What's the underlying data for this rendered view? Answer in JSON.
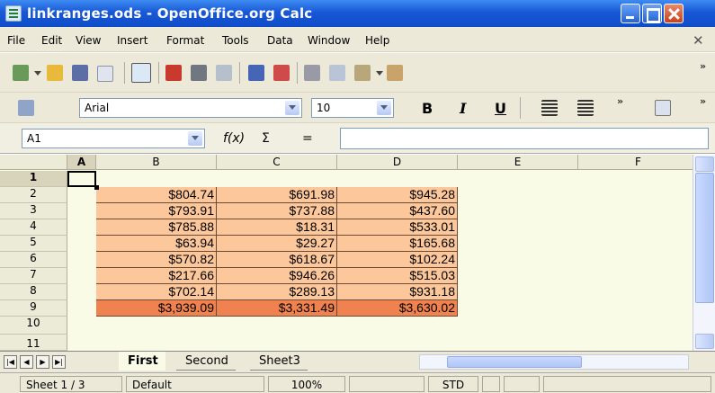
{
  "window": {
    "title": "linkranges.ods - OpenOffice.org Calc"
  },
  "menu": [
    "File",
    "Edit",
    "View",
    "Insert",
    "Format",
    "Tools",
    "Data",
    "Window",
    "Help"
  ],
  "format_bar": {
    "font_name": "Arial",
    "font_size": "10",
    "bold": "B",
    "italic": "I",
    "underline": "U"
  },
  "formula_bar": {
    "cell_ref": "A1",
    "function_wizard": "f(x)",
    "sum": "Σ",
    "equals": "=",
    "input_value": ""
  },
  "grid": {
    "columns": [
      "A",
      "B",
      "C",
      "D",
      "E",
      "F"
    ],
    "rows": [
      "1",
      "2",
      "3",
      "4",
      "5",
      "6",
      "7",
      "8",
      "9",
      "10",
      "11"
    ],
    "values": [
      [
        "$804.74",
        "$691.98",
        "$945.28"
      ],
      [
        "$793.91",
        "$737.88",
        "$437.60"
      ],
      [
        "$785.88",
        "$18.31",
        "$533.01"
      ],
      [
        "$63.94",
        "$29.27",
        "$165.68"
      ],
      [
        "$570.82",
        "$618.67",
        "$102.24"
      ],
      [
        "$217.66",
        "$946.26",
        "$515.03"
      ],
      [
        "$702.14",
        "$289.13",
        "$931.18"
      ],
      [
        "$3,939.09",
        "$3,331.49",
        "$3,630.02"
      ]
    ],
    "cell_color": "#fcc79b",
    "total_color": "#f0824f"
  },
  "sheets": [
    "First",
    "Second",
    "Sheet3"
  ],
  "status": {
    "sheet": "Sheet 1 / 3",
    "style": "Default",
    "zoom": "100%",
    "mode": "STD"
  }
}
